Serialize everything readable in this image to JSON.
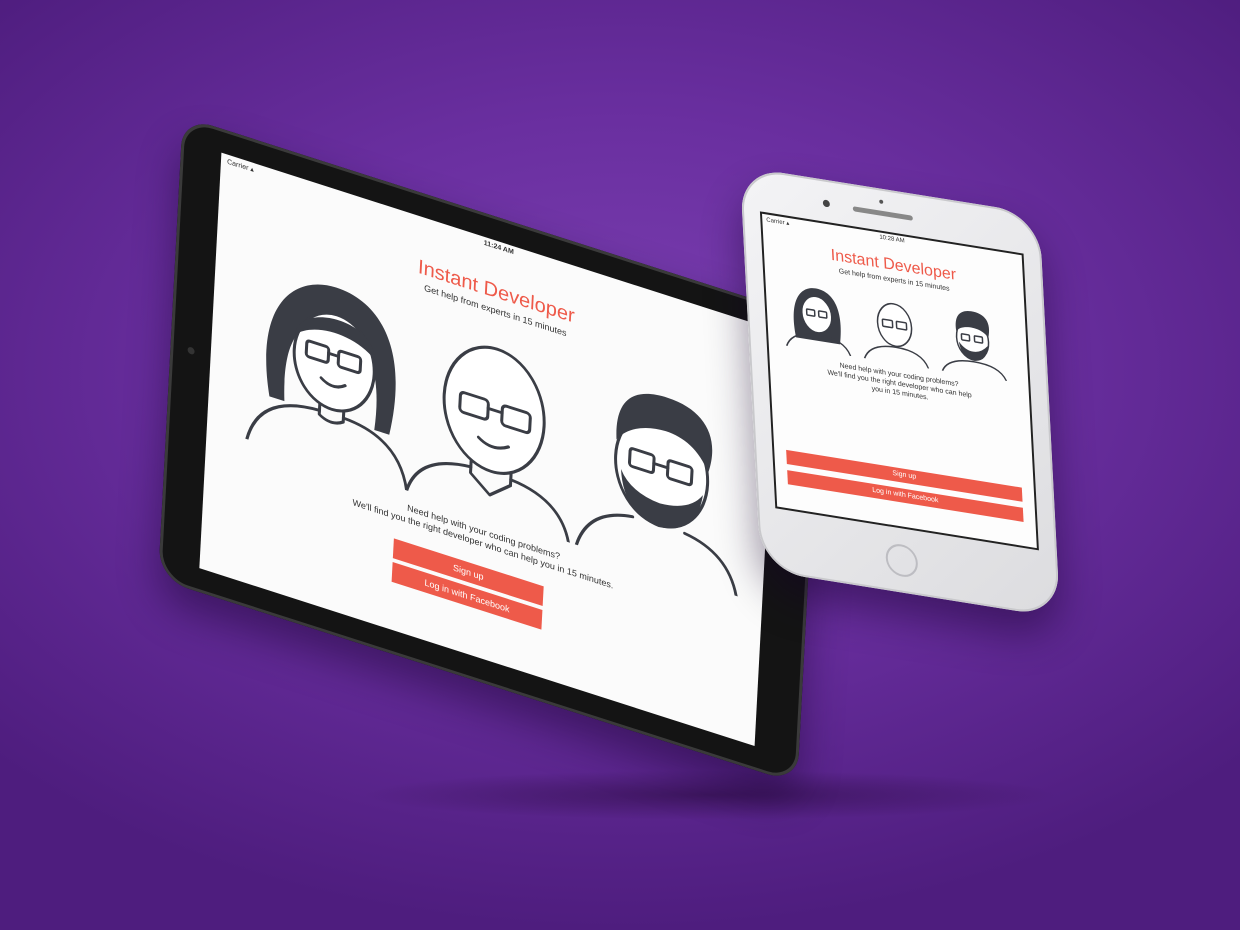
{
  "ipad": {
    "status": {
      "carrier": "Carrier",
      "time": "11:24 AM"
    },
    "title": "Instant Developer",
    "subtitle": "Get help from experts in 15 minutes",
    "copy_line1": "Need help with your coding problems?",
    "copy_line2": "We'll find you the right developer who can help you in 15 minutes.",
    "signup_label": "Sign up",
    "facebook_label": "Log in with Facebook"
  },
  "iphone": {
    "status": {
      "carrier": "Carrier",
      "time": "10:28 AM"
    },
    "title": "Instant Developer",
    "subtitle": "Get help from experts in 15 minutes",
    "copy_line1": "Need help with your coding problems?",
    "copy_line2": "We'll find you the right developer who can help",
    "copy_line3": "you in 15 minutes.",
    "signup_label": "Sign up",
    "facebook_label": "Log in with Facebook"
  },
  "colors": {
    "accent": "#ee5a4a",
    "background": "#6a2fa0",
    "illustration": "#3a3d45"
  },
  "icons": [
    "developer-woman-illustration",
    "developer-bald-man-illustration",
    "developer-bearded-man-illustration",
    "wifi-icon",
    "home-button"
  ]
}
